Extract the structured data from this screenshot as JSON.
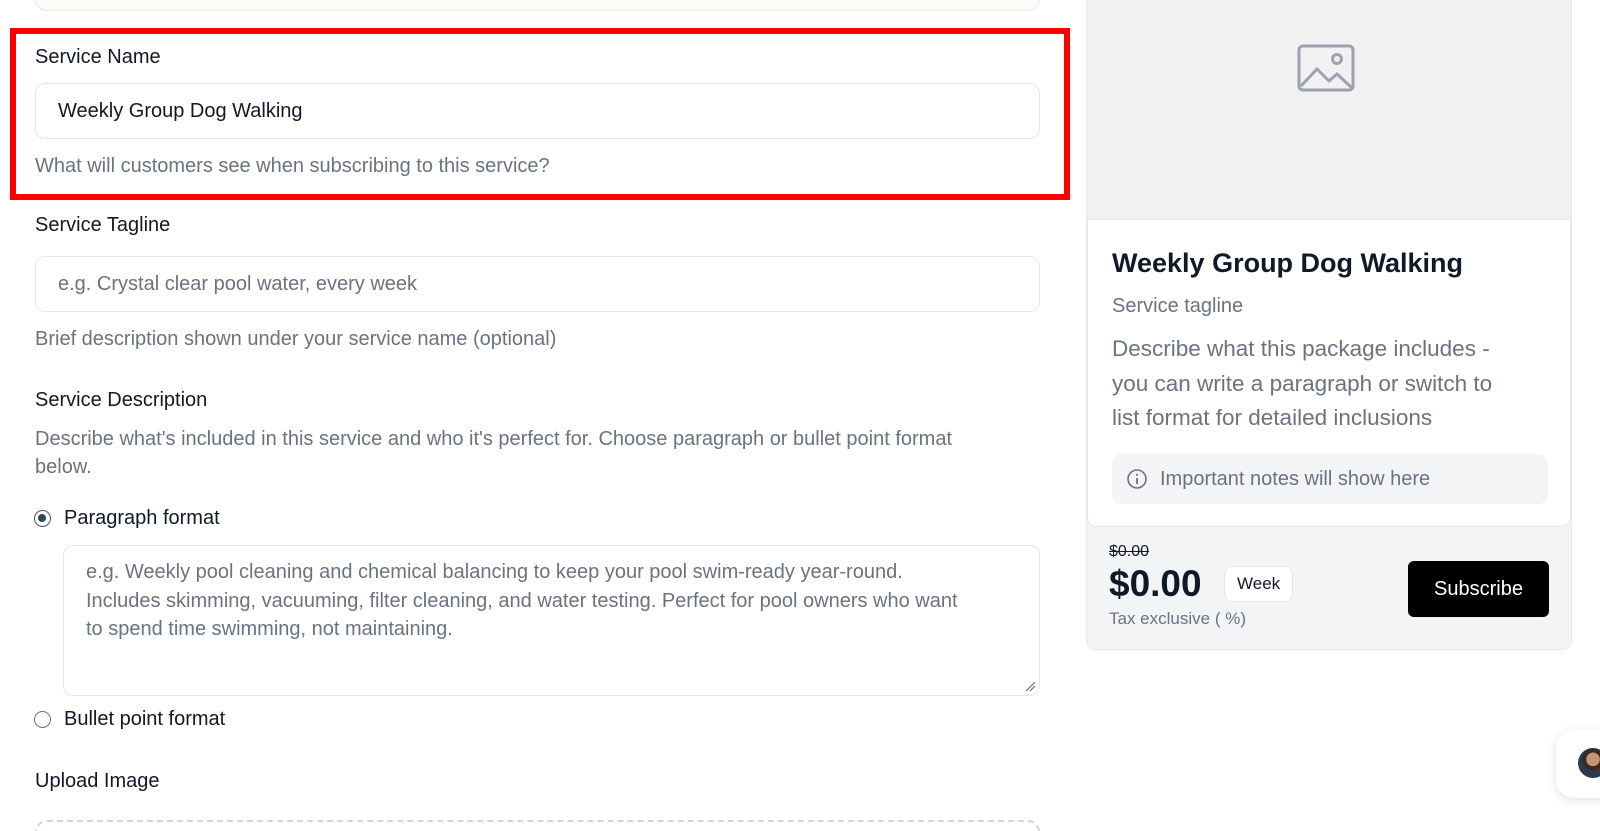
{
  "form": {
    "service_name": {
      "label": "Service Name",
      "value": "Weekly Group Dog Walking",
      "help": "What will customers see when subscribing to this service?"
    },
    "service_tagline": {
      "label": "Service Tagline",
      "placeholder": "e.g. Crystal clear pool water, every week",
      "help": "Brief description shown under your service name (optional)"
    },
    "service_description": {
      "label": "Service Description",
      "help_line1": "Describe what's included in this service and who it's perfect for. Choose paragraph or bullet point format",
      "help_line2": "below.",
      "options": [
        {
          "label": "Paragraph format",
          "selected": true
        },
        {
          "label": "Bullet point format",
          "selected": false
        }
      ],
      "placeholder_lines": [
        "e.g. Weekly pool cleaning and chemical balancing to keep your pool swim-ready year-round.",
        "Includes skimming, vacuuming, filter cleaning, and water testing. Perfect for pool owners who want",
        "to spend time swimming, not maintaining."
      ]
    },
    "upload_image": {
      "label": "Upload Image"
    }
  },
  "preview": {
    "image_icon": "image-placeholder-icon",
    "title": "Weekly Group Dog Walking",
    "tagline": "Service tagline",
    "description_lines": [
      "Describe what this package includes -",
      "you can write a paragraph or switch to",
      "list format for detailed inclusions"
    ],
    "notes": {
      "icon": "info-icon",
      "text": "Important notes will show here"
    },
    "original_price": "$0.00",
    "price": "$0.00",
    "period": "Week",
    "tax_note": "Tax exclusive ( %)",
    "subscribe_label": "Subscribe"
  },
  "colors": {
    "highlight": "#ff0000",
    "primary_button": "#000000",
    "radio_selected": "#2f4858",
    "muted_text": "#6b7280"
  }
}
